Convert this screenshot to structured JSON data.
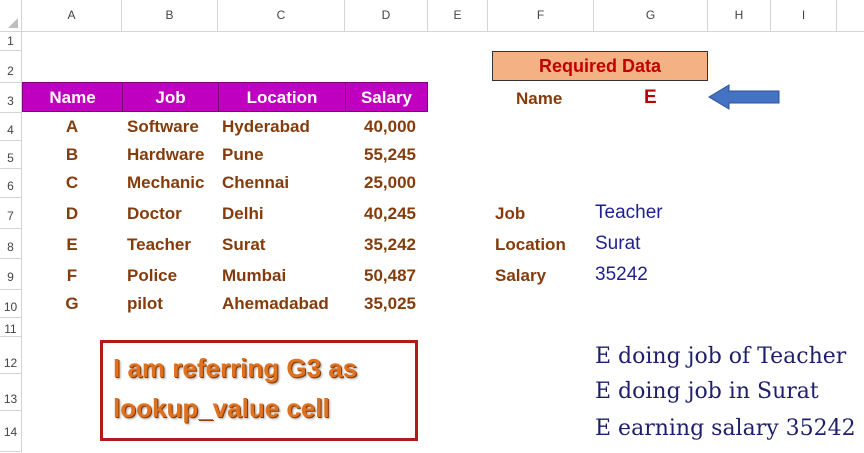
{
  "columns": [
    "A",
    "B",
    "C",
    "D",
    "E",
    "F",
    "G",
    "H",
    "I"
  ],
  "rows": [
    "1",
    "2",
    "3",
    "4",
    "5",
    "6",
    "7",
    "8",
    "9",
    "10",
    "11",
    "12",
    "13",
    "14"
  ],
  "table": {
    "headers": [
      "Name",
      "Job",
      "Location",
      "Salary"
    ],
    "records": [
      [
        "A",
        "Software",
        "Hyderabad",
        "40,000"
      ],
      [
        "B",
        "Hardware",
        "Pune",
        "55,245"
      ],
      [
        "C",
        "Mechanic",
        "Chennai",
        "25,000"
      ],
      [
        "D",
        "Doctor",
        "Delhi",
        "40,245"
      ],
      [
        "E",
        "Teacher",
        "Surat",
        "35,242"
      ],
      [
        "F",
        "Police",
        "Mumbai",
        "50,487"
      ],
      [
        "G",
        "pilot",
        "Ahemadabad",
        "35,025"
      ]
    ]
  },
  "lookup": {
    "title": "Required Data",
    "name_label": "Name",
    "name_value": "E",
    "job_label": "Job",
    "job_value": "Teacher",
    "location_label": "Location",
    "location_value": "Surat",
    "salary_label": "Salary",
    "salary_value": "35242"
  },
  "note": {
    "line1": "I am  referring G3 as",
    "line2": "lookup_value cell"
  },
  "summary": [
    "E doing job of Teacher",
    "E doing job in Surat",
    "E earning salary  35242"
  ],
  "colors": {
    "header_fill": "#c000c0",
    "required_fill": "#f4b183",
    "arrow": "#4472c4",
    "text_brown": "#843c0c",
    "note_border": "#b01c1c"
  },
  "icons": {
    "pointer": "left-arrow-icon"
  }
}
